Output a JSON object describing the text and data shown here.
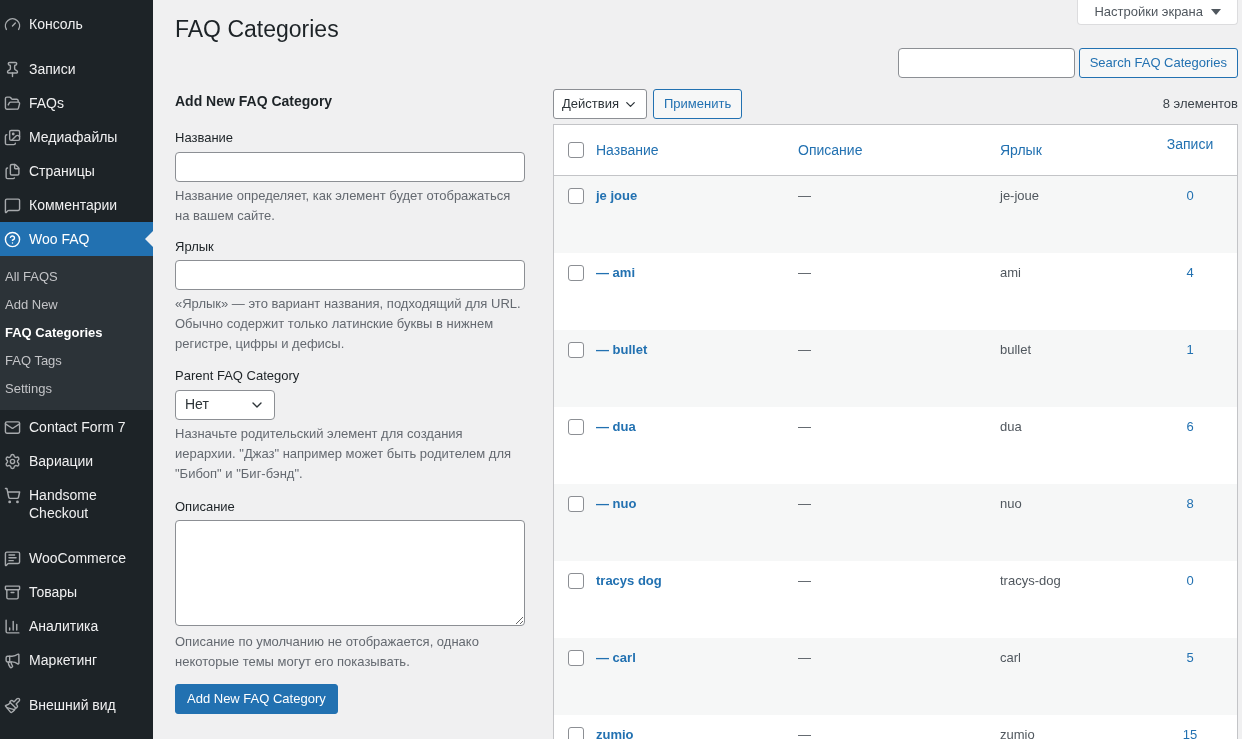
{
  "sidebar": {
    "groups": [
      [
        {
          "label": "Консоль",
          "selected": false
        }
      ],
      [
        {
          "label": "Записи",
          "selected": false
        },
        {
          "label": "FAQs",
          "selected": false
        },
        {
          "label": "Медиафайлы",
          "selected": false
        },
        {
          "label": "Страницы",
          "selected": false
        },
        {
          "label": "Комментарии",
          "selected": false
        },
        {
          "label": "Woo FAQ",
          "selected": true,
          "children": [
            {
              "label": "All FAQS",
              "selected": false
            },
            {
              "label": "Add New",
              "selected": false
            },
            {
              "label": "FAQ Categories",
              "selected": true
            },
            {
              "label": "FAQ Tags",
              "selected": false
            },
            {
              "label": "Settings",
              "selected": false
            }
          ]
        },
        {
          "label": "Contact Form 7",
          "selected": false
        },
        {
          "label": "Вариации",
          "selected": false
        },
        {
          "label": "Handsome Checkout",
          "selected": false
        }
      ],
      [
        {
          "label": "WooCommerce",
          "selected": false
        },
        {
          "label": "Товары",
          "selected": false
        },
        {
          "label": "Аналитика",
          "selected": false
        },
        {
          "label": "Маркетинг",
          "selected": false
        }
      ],
      [
        {
          "label": "Внешний вид",
          "selected": false
        }
      ]
    ]
  },
  "screen_options": "Настройки экрана",
  "title": "FAQ Categories",
  "search_button": "Search FAQ Categories",
  "form": {
    "heading": "Add New FAQ Category",
    "name_label": "Название",
    "name_hint": "Название определяет, как элемент будет отображаться на вашем сайте.",
    "slug_label": "Ярлык",
    "slug_hint": "«Ярлык» — это вариант названия, подходящий для URL. Обычно содержит только латинские буквы в нижнем регистре, цифры и дефисы.",
    "parent_label": "Parent FAQ Category",
    "parent_value": "Нет",
    "parent_hint": "Назначьте родительский элемент для создания иерархии. \"Джаз\" например может быть родителем для \"Бибоп\" и \"Биг-бэнд\".",
    "description_label": "Описание",
    "description_hint": "Описание по умолчанию не отображается, однако некоторые темы могут его показывать.",
    "submit": "Add New FAQ Category"
  },
  "bulk": {
    "action": "Действия",
    "apply": "Применить",
    "count": "8 элементов"
  },
  "table": {
    "all_checked": false,
    "columns": [
      "Название",
      "Описание",
      "Ярлык",
      "Записи"
    ],
    "rows": [
      {
        "name": "je joue",
        "description": "—",
        "slug": "je-joue",
        "count": "0",
        "checked": false
      },
      {
        "name": "— ami",
        "description": "—",
        "slug": "ami",
        "count": "4",
        "checked": false
      },
      {
        "name": "— bullet",
        "description": "—",
        "slug": "bullet",
        "count": "1",
        "checked": false
      },
      {
        "name": "— dua",
        "description": "—",
        "slug": "dua",
        "count": "6",
        "checked": false
      },
      {
        "name": "— nuo",
        "description": "—",
        "slug": "nuo",
        "count": "8",
        "checked": false
      },
      {
        "name": "tracys dog",
        "description": "—",
        "slug": "tracys-dog",
        "count": "0",
        "checked": false
      },
      {
        "name": "— carl",
        "description": "—",
        "slug": "carl",
        "count": "5",
        "checked": false
      },
      {
        "name": "zumio",
        "description": "—",
        "slug": "zumio",
        "count": "15",
        "checked": false
      }
    ]
  }
}
